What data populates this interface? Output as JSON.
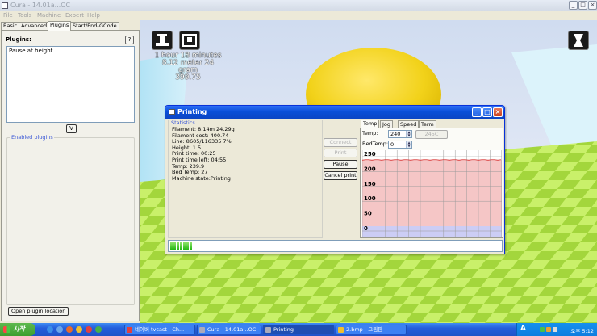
{
  "window": {
    "title": "Cura - 14.01a...OC",
    "menu": [
      "File",
      "Tools",
      "Machine",
      "Expert",
      "Help"
    ]
  },
  "left_panel": {
    "tabs": [
      "Basic",
      "Advanced",
      "Plugins",
      "Start/End-GCode"
    ],
    "active_tab": "Plugins",
    "plugins_label": "Plugins:",
    "help_button": "?",
    "plugin_list": [
      "Pause at height"
    ],
    "expand_button": "V",
    "enabled_plugins_label": "Enabled plugins",
    "open_location_button": "Open plugin location"
  },
  "scene": {
    "print_time": "1 hour 18 minutes",
    "filament": "8.12 meter 24 gram",
    "cost": "399.75",
    "colors": {
      "model": "#f2d21a",
      "bed_light": "#c9f06a",
      "bed_dark": "#a3d63c",
      "background": "#dbe4f4"
    }
  },
  "dialog": {
    "title": "Printing",
    "stats_label": "Statistics",
    "stats": [
      "Filament: 8.14m 24.29g",
      "Filament cost: 400.74",
      "Line: 8605/116335 7%",
      "Height: 1.5",
      "Print time: 00:25",
      "Print time left: 04:55",
      "Temp: 239.9",
      "Bed Temp: 27",
      "Machine state:Printing"
    ],
    "buttons": {
      "connect": "Connect",
      "print": "Print",
      "pause": "Pause",
      "cancel": "Cancel print"
    },
    "tabs": [
      "Temp",
      "Jog",
      "Speed",
      "Term"
    ],
    "active_tab": "Temp",
    "temp_label": "Temp:",
    "temp_value": "240",
    "preset_button": "245C",
    "bed_label": "BedTemp:",
    "bed_value": "0",
    "graph": {
      "y_ticks": [
        "250",
        "200",
        "150",
        "100",
        "50",
        "0"
      ],
      "ymax": 250,
      "current_temp": 239.9,
      "target_temp": 240,
      "colors": {
        "target_fill": "#f5c6c6",
        "line": "#d62f2f",
        "bed_fill": "#cccdf5"
      }
    },
    "progress_percent": 7
  },
  "taskbar": {
    "start": "시작",
    "items": [
      "네이버 tvcast - Ch...",
      "Cura - 14.01a...OC",
      "Printing",
      "2.bmp - 그림판"
    ],
    "active_item": "Printing",
    "tray_label": "A",
    "clock": "오후 5:12"
  }
}
